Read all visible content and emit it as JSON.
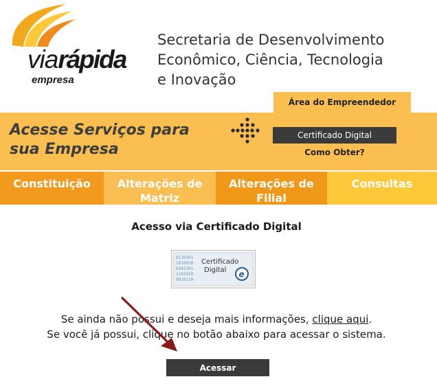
{
  "logo": {
    "brand_via": "via",
    "brand_rapida": "rápida",
    "sub": "empresa"
  },
  "header": {
    "org_line1": "Secretaria de Desenvolvimento",
    "org_line2": "Econômico, Ciência, Tecnologia",
    "org_line3": "e Inovação"
  },
  "area_tab": "Área do Empreendedor",
  "banner": {
    "title_line1": "Acesse Serviços para",
    "title_line2": "sua Empresa",
    "cert_button": "Certificado Digital",
    "como_obter": "Como Obter?"
  },
  "tabs": [
    {
      "line1": "Constituição",
      "line2": ""
    },
    {
      "line1": "Alterações de",
      "line2": "Matriz"
    },
    {
      "line1": "Alterações de",
      "line2": "Filial"
    },
    {
      "line1": "Consultas",
      "line2": ""
    }
  ],
  "main": {
    "heading": "Acesso via Certificado Digital",
    "cert_logo_line1": "Certificado",
    "cert_logo_line2": "Digital",
    "cert_logo_badge": "e",
    "info_line1_pre": "Se ainda não possui e deseja mais informações, ",
    "info_link": "clique aqui",
    "info_line1_post": ".",
    "info_line2": "Se você já possui, clique no botão abaixo para acessar o sistema.",
    "acessar_button": "Acessar"
  },
  "colors": {
    "orange_banner": "#fbbf51",
    "dark_button": "#3a3a3a",
    "arrow": "#8b1a1a"
  }
}
